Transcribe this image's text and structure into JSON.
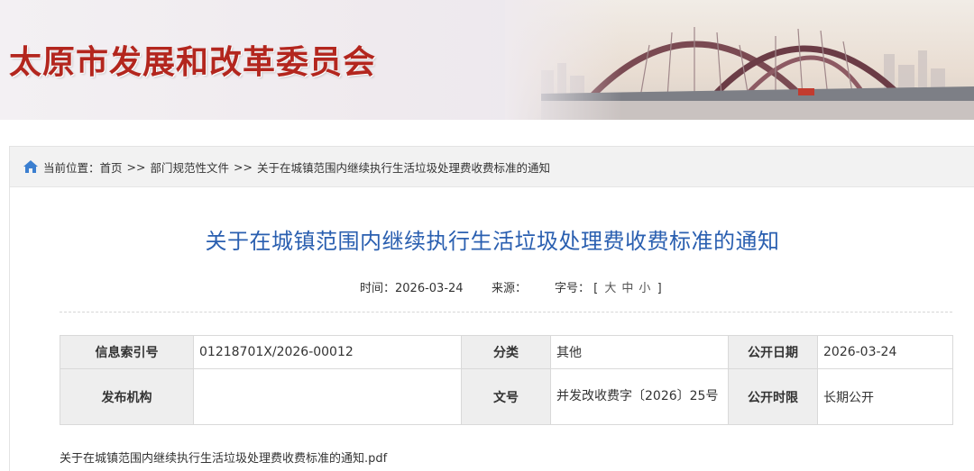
{
  "header": {
    "site_title": "太原市发展和改革委员会"
  },
  "breadcrumb": {
    "prefix": "当前位置：",
    "items": [
      "首页",
      "部门规范性文件",
      "关于在城镇范围内继续执行生活垃圾处理费收费标准的通知"
    ],
    "separator": ">>"
  },
  "article": {
    "title": "关于在城镇范围内继续执行生活垃圾处理费收费标准的通知",
    "time_label": "时间：",
    "time_value": "2026-03-24",
    "source_label": "来源：",
    "source_value": "",
    "font_size_label": "字号：",
    "font_size_open": "[",
    "font_size_options": [
      "大",
      "中",
      "小"
    ],
    "font_size_close": "]"
  },
  "info_table": {
    "row1": {
      "index_label": "信息索引号",
      "index_value": "01218701X/2026-00012",
      "category_label": "分类",
      "category_value": "其他",
      "date_label": "公开日期",
      "date_value": "2026-03-24"
    },
    "row2": {
      "org_label": "发布机构",
      "org_value": "",
      "docno_label": "文号",
      "docno_value": "并发改收费字〔2026〕25号",
      "period_label": "公开时限",
      "period_value": "长期公开"
    }
  },
  "attachment": {
    "filename": "关于在城镇范围内继续执行生活垃圾处理费收费标准的通知.pdf"
  },
  "colors": {
    "title_red": "#b3261e",
    "article_title_blue": "#2a5fb0",
    "label_bg": "#eeeeee",
    "breadcrumb_bg": "#f2f2f2"
  }
}
